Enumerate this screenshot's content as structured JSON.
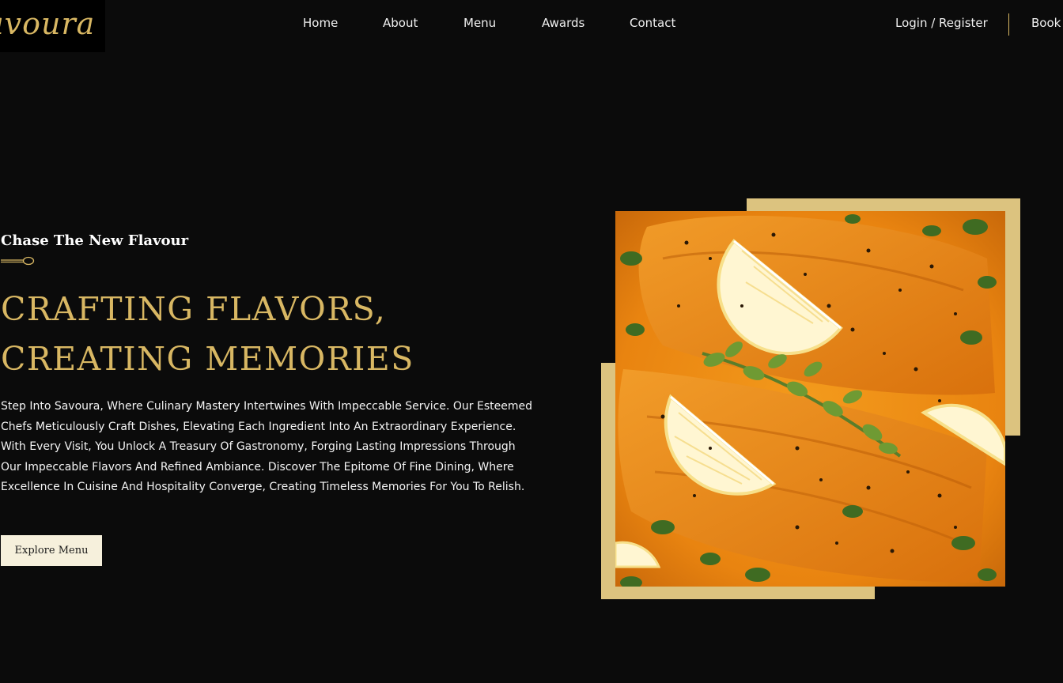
{
  "brand": {
    "logo_text": "avoura"
  },
  "nav": {
    "home": "Home",
    "about": "About",
    "menu": "Menu",
    "awards": "Awards",
    "contact": "Contact"
  },
  "header_actions": {
    "login": "Login / Register",
    "book": "Book"
  },
  "hero": {
    "tagline": "Chase The New Flavour",
    "title_line1": "CRAFTING FLAVORS,",
    "title_line2": "CREATING MEMORIES",
    "description": "Step Into Savoura, Where Culinary Mastery Intertwines With Impeccable Service. Our Esteemed Chefs Meticulously Craft Dishes, Elevating Each Ingredient Into An Extraordinary Experience. With Every Visit, You Unlock A Treasury Of Gastronomy, Forging Lasting Impressions Through Our Impeccable Flavors And Refined Ambiance. Discover The Epitome Of Fine Dining, Where Excellence In Cuisine And Hospitality Converge, Creating Timeless Memories For You To Relish.",
    "cta": "Explore Menu"
  },
  "colors": {
    "background": "#0b0b0b",
    "gold_accent": "#d8b763",
    "frame": "#dcc37f",
    "button_bg": "#f6f0dc"
  },
  "icons": {
    "divider": "spoon-icon"
  }
}
